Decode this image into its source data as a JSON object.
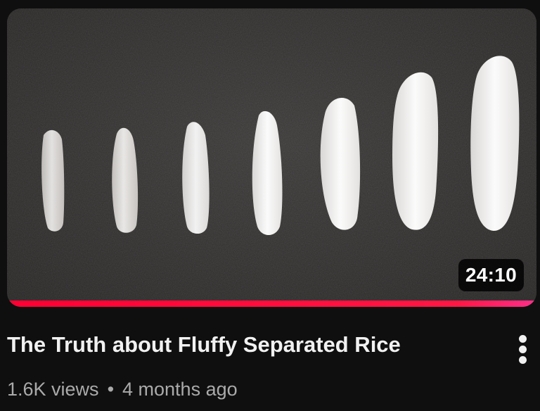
{
  "video": {
    "title": "The Truth about Fluffy Separated Rice",
    "views": "1.6K views",
    "separator": "•",
    "age": "4 months ago",
    "duration": "24:10",
    "watch_progress": 1.0
  },
  "icons": {
    "menu": "more-vert-icon"
  },
  "colors": {
    "background": "#0f0f0f",
    "progress": "#ff0033",
    "title_text": "#f1f1f1",
    "meta_text": "#aaaaaa"
  }
}
